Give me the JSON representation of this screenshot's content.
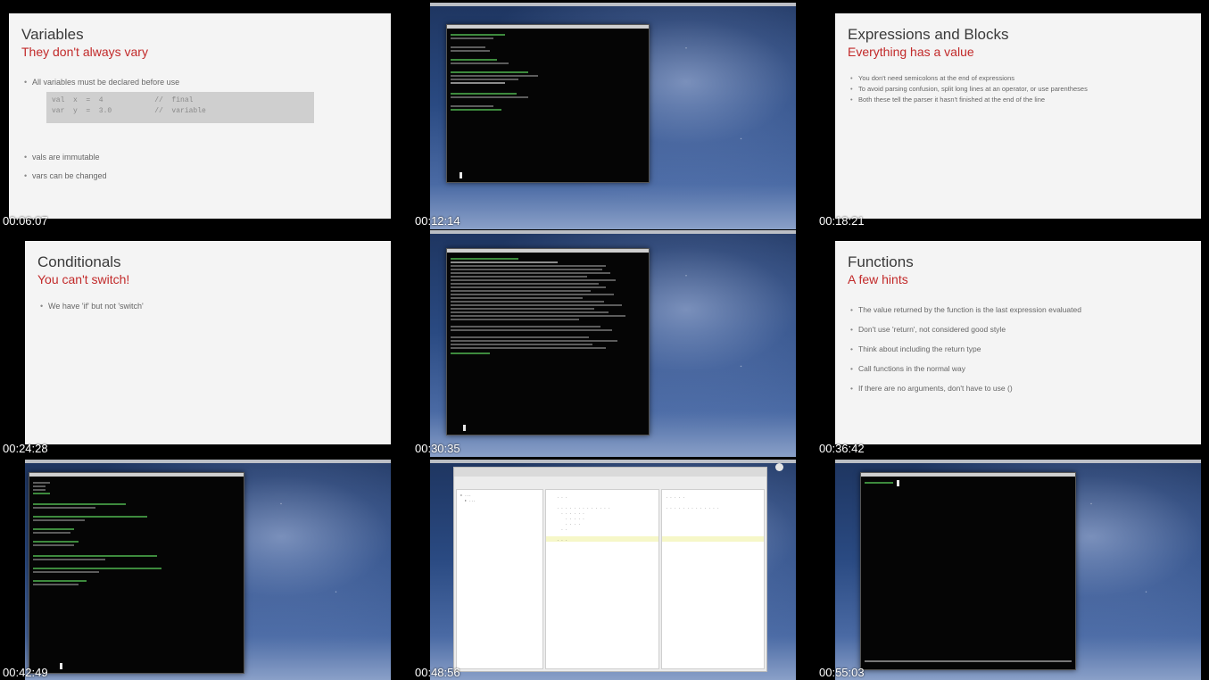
{
  "tiles": [
    {
      "timestamp": "00:06:07",
      "title": "Variables",
      "subtitle": "They don't always vary",
      "bullets_top": [
        "All variables must be declared before use"
      ],
      "code": "val  x  =  4            //  final\nvar  y  =  3.0          //  variable",
      "bullets_bottom": [
        "vals are immutable",
        "vars can be changed"
      ]
    },
    {
      "timestamp": "00:12:14"
    },
    {
      "timestamp": "00:18:21",
      "title": "Expressions and Blocks",
      "subtitle": "Everything has a value",
      "bullets": [
        "You don't need semicolons at the end of expressions",
        "To avoid parsing confusion, split long lines at an operator, or use parentheses",
        "Both these tell the parser it hasn't finished at the end of the line"
      ]
    },
    {
      "timestamp": "00:24:28",
      "title": "Conditionals",
      "subtitle": "You can't switch!",
      "bullets": [
        "We have 'if' but not 'switch'"
      ]
    },
    {
      "timestamp": "00:30:35"
    },
    {
      "timestamp": "00:36:42",
      "title": "Functions",
      "subtitle": "A few hints",
      "bullets": [
        "The value returned by the function is the last expression evaluated",
        "Don't use 'return', not considered good style",
        "Think about including the return type",
        "Call functions in the normal way",
        "If there are no arguments, don't have to use ()"
      ]
    },
    {
      "timestamp": "00:42:49"
    },
    {
      "timestamp": "00:48:56"
    },
    {
      "timestamp": "00:55:03"
    }
  ],
  "colors": {
    "slide_background": "#f4f4f4",
    "slide_title": "#3a3a3a",
    "slide_subtitle": "#c22a2a",
    "terminal_background": "#050505",
    "separator": "#000000"
  }
}
